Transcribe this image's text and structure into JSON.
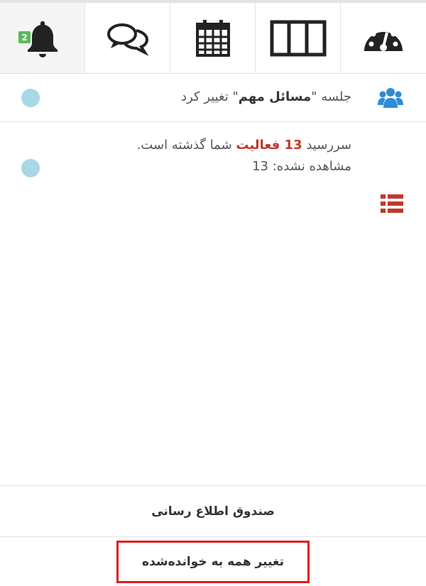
{
  "tabs": [
    {
      "icon": "bell-icon",
      "badge": "2",
      "active": true
    },
    {
      "icon": "chat-bubbles-icon"
    },
    {
      "icon": "calendar-icon"
    },
    {
      "icon": "columns-icon"
    },
    {
      "icon": "dashboard-gauge-icon"
    }
  ],
  "notifications": [
    {
      "icon": "users-icon",
      "pre": "جلسه \"",
      "bold": "مسائل مهم",
      "post": "\" تغییر کرد"
    },
    {
      "icon": "list-icon",
      "line1_pre": "سررسید ",
      "line1_highlight": "13 فعالیت",
      "line1_post": " شما گذشته است.",
      "line2": "مشاهده نشده: 13"
    }
  ],
  "footer": {
    "inbox_label": "صندوق اطلاع رسانی",
    "mark_all_label": "تغییر همه به خوانده‌شده"
  },
  "colors": {
    "badge": "#5cb85c",
    "users_icon": "#2e8bd6",
    "list_icon": "#c0392b",
    "unread_dot": "#a8d7e8",
    "highlight_box": "#e01b1b"
  }
}
